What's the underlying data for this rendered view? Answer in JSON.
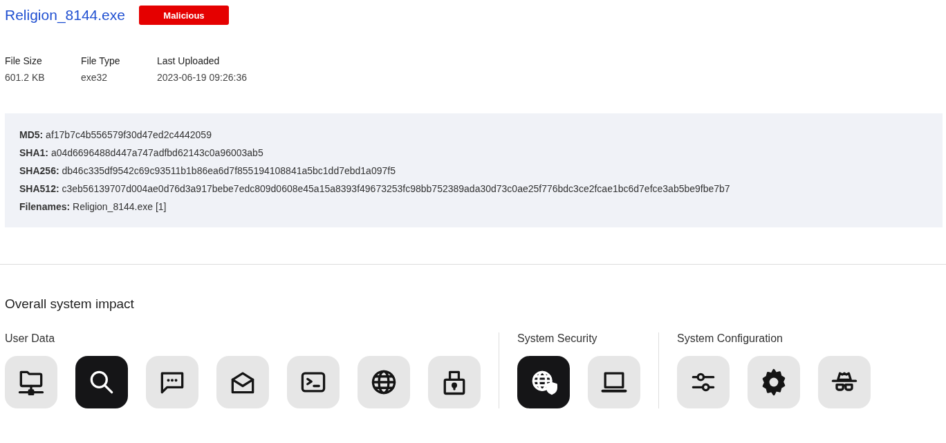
{
  "file": {
    "name": "Religion_8144.exe",
    "verdict": "Malicious"
  },
  "meta": [
    {
      "label": "File Size",
      "value": "601.2 KB"
    },
    {
      "label": "File Type",
      "value": "exe32"
    },
    {
      "label": "Last Uploaded",
      "value": "2023-06-19 09:26:36"
    }
  ],
  "hashes": [
    "**MD5:** af17b7c4b556579f30d47ed2c4442059",
    "**SHA1:** a04d6696488d447a747adfbd62143c0a96003ab5",
    "**SHA256:** db46c335df9542c69c93511b1b86ea6d7f855194108841a5bc1dd7ebd1a097f5",
    "**SHA512:** c3eb56139707d004ae0d76d3a917bebe7edc809d0608e45a15a8393f49673253fc98bb752389ada30d73c0ae25f776bdc3ce2fcae1bc6d7efce3ab5be9fbe7b7",
    "**Filenames:** Religion_8144.exe [1]"
  ],
  "impact": {
    "title": "Overall system impact",
    "groups": [
      {
        "label": "User Data",
        "items": [
          {
            "kind": "network-folder",
            "selected": false
          },
          {
            "kind": "search",
            "selected": true
          },
          {
            "kind": "chat",
            "selected": false
          },
          {
            "kind": "mail",
            "selected": false
          },
          {
            "kind": "terminal",
            "selected": false
          },
          {
            "kind": "globe",
            "selected": false
          },
          {
            "kind": "lock",
            "selected": false
          }
        ]
      },
      {
        "label": "System Security",
        "items": [
          {
            "kind": "globe-shield",
            "selected": true
          },
          {
            "kind": "laptop",
            "selected": false
          }
        ]
      },
      {
        "label": "System Configuration",
        "items": [
          {
            "kind": "sliders",
            "selected": false
          },
          {
            "kind": "gear",
            "selected": false
          },
          {
            "kind": "spy",
            "selected": false
          }
        ]
      }
    ]
  }
}
